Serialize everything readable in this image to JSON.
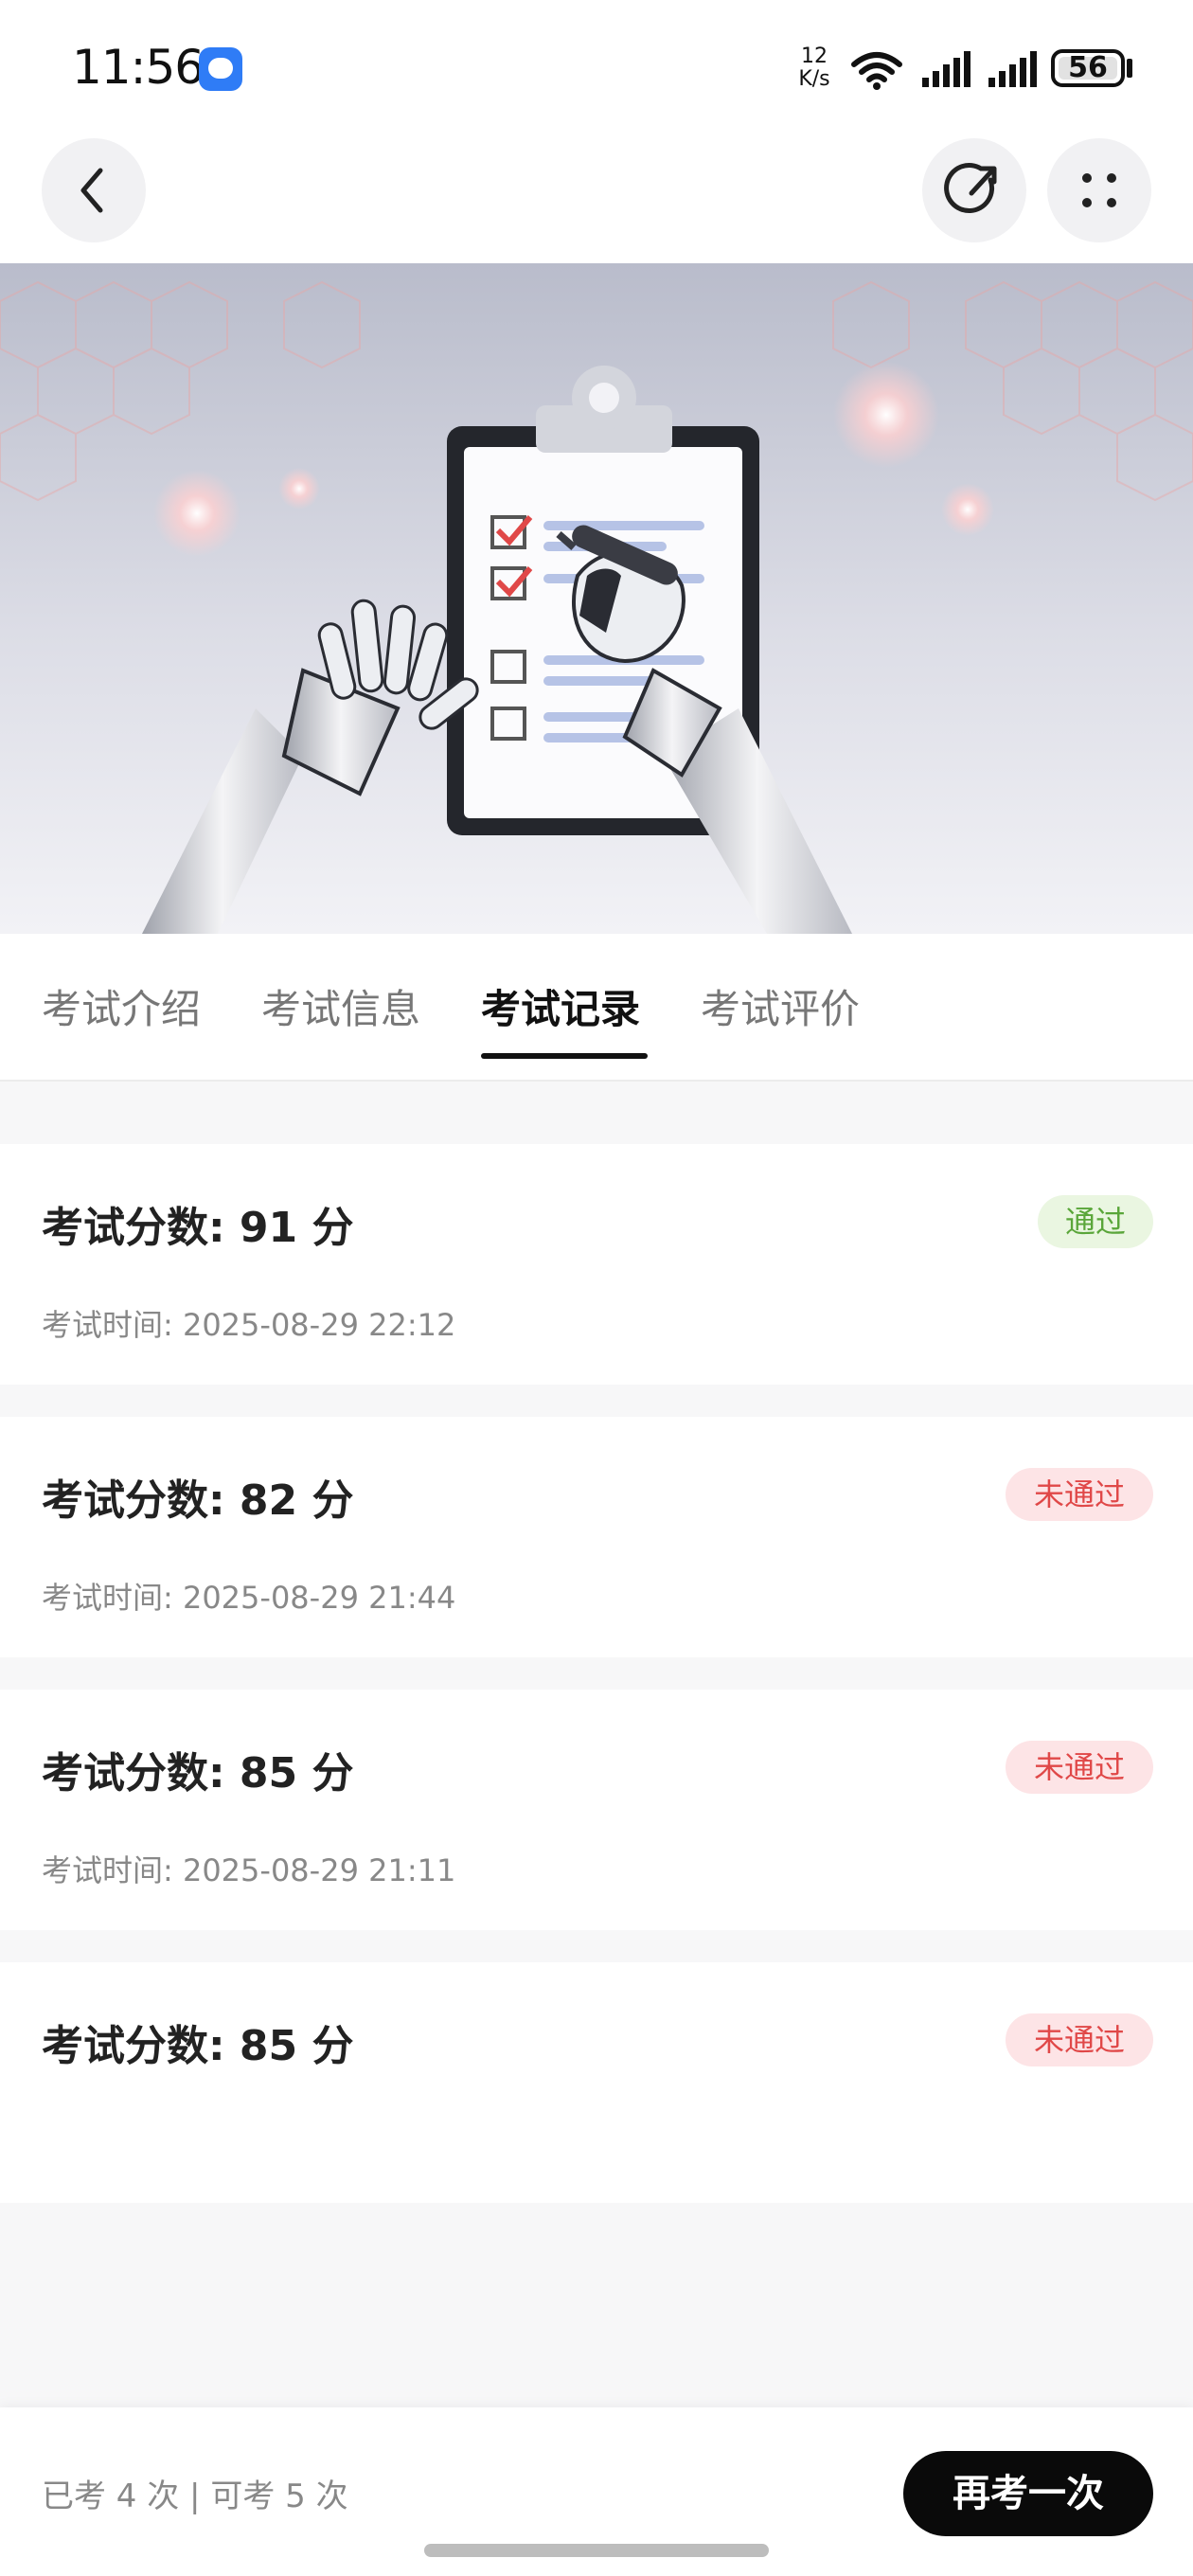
{
  "status_bar": {
    "time": "11:56",
    "net_speed_value": "12",
    "net_speed_unit": "K/s",
    "battery": "56"
  },
  "tabs": [
    {
      "label": "考试介绍"
    },
    {
      "label": "考试信息"
    },
    {
      "label": "考试记录"
    },
    {
      "label": "考试评价"
    }
  ],
  "active_tab": "考试记录",
  "records": [
    {
      "score": "考试分数: 91 分",
      "time": "考试时间: 2025-08-29 22:12",
      "status": "通过"
    },
    {
      "score": "考试分数: 82 分",
      "time": "考试时间: 2025-08-29 21:44",
      "status": "未通过"
    },
    {
      "score": "考试分数: 85 分",
      "time": "考试时间: 2025-08-29 21:11",
      "status": "未通过"
    },
    {
      "score": "考试分数: 85 分",
      "time": "",
      "status": "未通过"
    }
  ],
  "bottom_bar": {
    "attempts": "已考 4 次 | 可考 5 次",
    "retake_label": "再考一次"
  },
  "colors": {
    "pass_text": "#5aa63a",
    "pass_bg": "#eaf6e1",
    "fail_text": "#e04848",
    "fail_bg": "#fde4e6",
    "primary_button": "#0a0a0a"
  }
}
